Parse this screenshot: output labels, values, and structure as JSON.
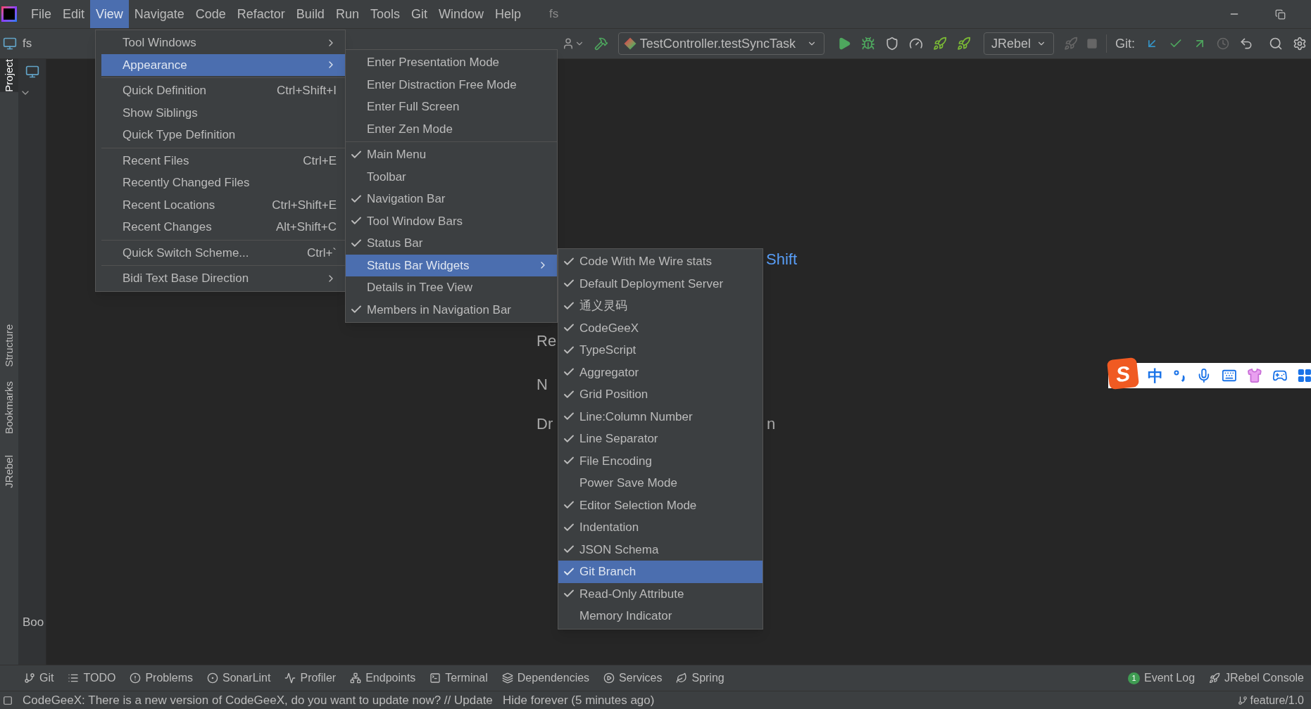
{
  "menubar": {
    "items": [
      {
        "label": "File",
        "selected": false
      },
      {
        "label": "Edit",
        "selected": false
      },
      {
        "label": "View",
        "selected": true
      },
      {
        "label": "Navigate",
        "selected": false
      },
      {
        "label": "Code",
        "selected": false
      },
      {
        "label": "Refactor",
        "selected": false
      },
      {
        "label": "Build",
        "selected": false
      },
      {
        "label": "Run",
        "selected": false
      },
      {
        "label": "Tools",
        "selected": false
      },
      {
        "label": "Git",
        "selected": false
      },
      {
        "label": "Window",
        "selected": false
      },
      {
        "label": "Help",
        "selected": false
      }
    ],
    "project_title": "fs"
  },
  "navigation": {
    "breadcrumb": "fs"
  },
  "toolbar": {
    "run_config": "TestController.testSyncTask",
    "jrebel": "JRebel",
    "git_label": "Git:"
  },
  "side_stripe": [
    {
      "label": "Project",
      "selected": true
    },
    {
      "label": "Structure",
      "selected": false
    },
    {
      "label": "Bookmarks",
      "selected": false
    },
    {
      "label": "JRebel",
      "selected": false
    }
  ],
  "project_panel": {
    "bottom_label": "Boo"
  },
  "editor_hints": [
    {
      "text": "Shift",
      "kind": "shortcut"
    },
    {
      "text": "Re",
      "kind": "plain"
    },
    {
      "text": "N",
      "kind": "plain"
    },
    {
      "text": "Dr",
      "kind": "plain"
    },
    {
      "text": "n",
      "kind": "plain"
    }
  ],
  "view_menu": {
    "items": [
      {
        "kind": "item",
        "label": "Tool Windows",
        "submenu": true,
        "selected": false
      },
      {
        "kind": "item",
        "label": "Appearance",
        "submenu": true,
        "selected": true
      },
      {
        "kind": "separator"
      },
      {
        "kind": "item",
        "label": "Quick Definition",
        "shortcut": "Ctrl+Shift+I",
        "selected": false
      },
      {
        "kind": "item",
        "label": "Show Siblings",
        "selected": false
      },
      {
        "kind": "item",
        "label": "Quick Type Definition",
        "selected": false
      },
      {
        "kind": "separator"
      },
      {
        "kind": "item",
        "label": "Recent Files",
        "shortcut": "Ctrl+E",
        "selected": false
      },
      {
        "kind": "item",
        "label": "Recently Changed Files",
        "selected": false
      },
      {
        "kind": "item",
        "label": "Recent Locations",
        "shortcut": "Ctrl+Shift+E",
        "selected": false
      },
      {
        "kind": "item",
        "label": "Recent Changes",
        "shortcut": "Alt+Shift+C",
        "selected": false
      },
      {
        "kind": "separator"
      },
      {
        "kind": "item",
        "label": "Quick Switch Scheme...",
        "shortcut": "Ctrl+`",
        "selected": false
      },
      {
        "kind": "separator"
      },
      {
        "kind": "item",
        "label": "Bidi Text Base Direction",
        "submenu": true,
        "selected": false
      }
    ]
  },
  "appearance_menu": {
    "items": [
      {
        "kind": "item",
        "label": "Enter Presentation Mode",
        "checked": false,
        "selected": false
      },
      {
        "kind": "item",
        "label": "Enter Distraction Free Mode",
        "checked": false,
        "selected": false
      },
      {
        "kind": "item",
        "label": "Enter Full Screen",
        "checked": false,
        "selected": false
      },
      {
        "kind": "item",
        "label": "Enter Zen Mode",
        "checked": false,
        "selected": false
      },
      {
        "kind": "separator"
      },
      {
        "kind": "item",
        "label": "Main Menu",
        "checked": true,
        "selected": false
      },
      {
        "kind": "item",
        "label": "Toolbar",
        "checked": false,
        "selected": false
      },
      {
        "kind": "item",
        "label": "Navigation Bar",
        "checked": true,
        "selected": false
      },
      {
        "kind": "item",
        "label": "Tool Window Bars",
        "checked": true,
        "selected": false
      },
      {
        "kind": "item",
        "label": "Status Bar",
        "checked": true,
        "selected": false
      },
      {
        "kind": "item",
        "label": "Status Bar Widgets",
        "checked": false,
        "submenu": true,
        "selected": true
      },
      {
        "kind": "item",
        "label": "Details in Tree View",
        "checked": false,
        "selected": false
      },
      {
        "kind": "item",
        "label": "Members in Navigation Bar",
        "checked": true,
        "selected": false
      }
    ]
  },
  "widgets_menu": {
    "items": [
      {
        "label": "Code With Me Wire stats",
        "checked": true,
        "selected": false
      },
      {
        "label": "Default Deployment Server",
        "checked": true,
        "selected": false
      },
      {
        "label": "通义灵码",
        "checked": true,
        "selected": false
      },
      {
        "label": "CodeGeeX",
        "checked": true,
        "selected": false
      },
      {
        "label": "TypeScript",
        "checked": true,
        "selected": false
      },
      {
        "label": "Aggregator",
        "checked": true,
        "selected": false
      },
      {
        "label": "Grid Position",
        "checked": true,
        "selected": false
      },
      {
        "label": "Line:Column Number",
        "checked": true,
        "selected": false
      },
      {
        "label": "Line Separator",
        "checked": true,
        "selected": false
      },
      {
        "label": "File Encoding",
        "checked": true,
        "selected": false
      },
      {
        "label": "Power Save Mode",
        "checked": false,
        "selected": false
      },
      {
        "label": "Editor Selection Mode",
        "checked": true,
        "selected": false
      },
      {
        "label": "Indentation",
        "checked": true,
        "selected": false
      },
      {
        "label": "JSON Schema",
        "checked": true,
        "selected": false
      },
      {
        "label": "Git Branch",
        "checked": true,
        "selected": true
      },
      {
        "label": "Read-Only Attribute",
        "checked": true,
        "selected": false
      },
      {
        "label": "Memory Indicator",
        "checked": false,
        "selected": false
      }
    ]
  },
  "ime_bar": {
    "logo": "S",
    "mode": "中"
  },
  "tool_windows": {
    "left": [
      {
        "label": "Git",
        "kind": "git"
      },
      {
        "label": "TODO",
        "kind": "todo"
      },
      {
        "label": "Problems",
        "kind": "problems"
      },
      {
        "label": "SonarLint",
        "kind": "sonar"
      },
      {
        "label": "Profiler",
        "kind": "profiler"
      },
      {
        "label": "Endpoints",
        "kind": "endpoints"
      },
      {
        "label": "Terminal",
        "kind": "terminal"
      },
      {
        "label": "Dependencies",
        "kind": "dependencies"
      },
      {
        "label": "Services",
        "kind": "services"
      },
      {
        "label": "Spring",
        "kind": "spring"
      }
    ],
    "right": [
      {
        "label": "Event Log",
        "kind": "eventlog",
        "badge": "1"
      },
      {
        "label": "JRebel Console",
        "kind": "jrebel"
      }
    ]
  },
  "status_bar": {
    "message": "CodeGeeX: There is a new version of CodeGeeX, do you want to update now? // Update   Hide forever (5 minutes ago)",
    "branch": "feature/1.0"
  }
}
